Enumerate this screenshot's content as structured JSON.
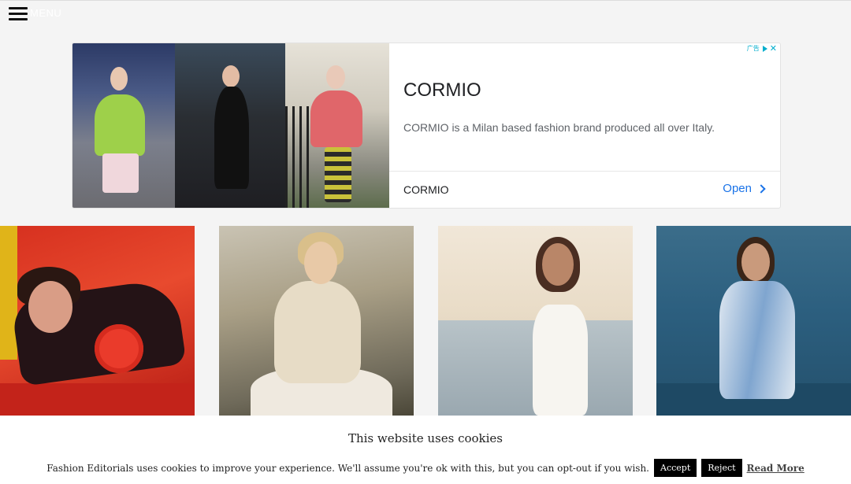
{
  "header": {
    "menu_label": "MENU",
    "menu_icon": "hamburger-icon"
  },
  "ad": {
    "title": "CORMIO",
    "description": "CORMIO is a Milan based fashion brand produced all over Italy.",
    "brand": "CORMIO",
    "cta_label": "Open",
    "choices_icon": "adchoices-icon",
    "choices_text": "广告",
    "close_icon": "close-icon",
    "close_glyph": "✕",
    "accent_color": "#1a73e8"
  },
  "gallery": {
    "items": [
      {
        "alt": "Editorial photo - woman in red set"
      },
      {
        "alt": "Editorial photo - woman in knit sweater"
      },
      {
        "alt": "Editorial photo - woman in white dress"
      },
      {
        "alt": "Editorial photo - woman in striped shirt in sea"
      }
    ]
  },
  "cookie": {
    "title": "This website uses cookies",
    "text": "Fashion Editorials uses cookies to improve your experience. We'll assume you're ok with this, but you can opt-out if you wish.",
    "accept_label": "Accept",
    "reject_label": "Reject",
    "read_more_label": "Read More"
  }
}
